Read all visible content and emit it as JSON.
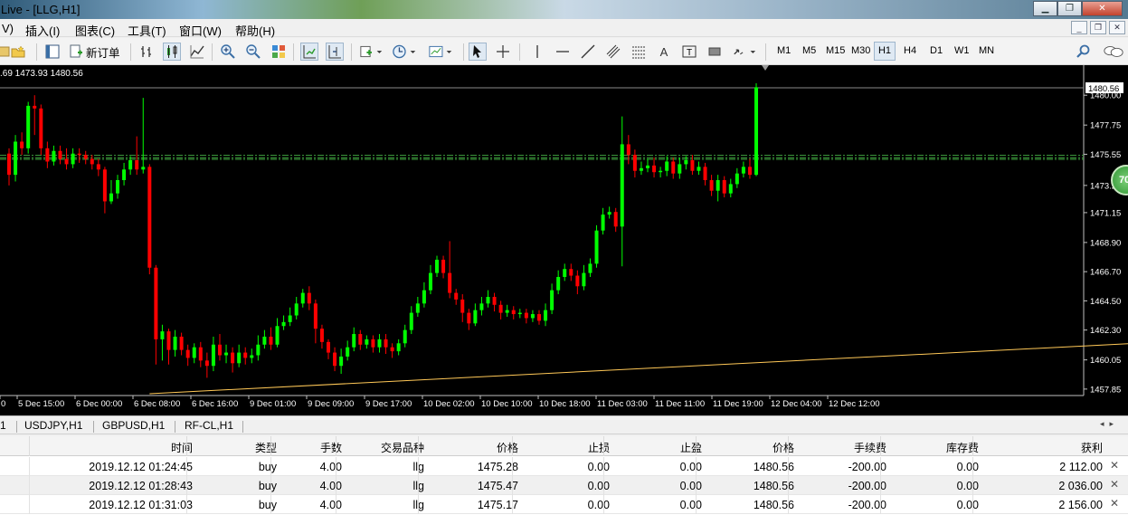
{
  "window": {
    "title": "Live - [LLG,H1]"
  },
  "menu": {
    "items": [
      "V)",
      "插入(I)",
      "图表(C)",
      "工具(T)",
      "窗口(W)",
      "帮助(H)"
    ]
  },
  "toolbar": {
    "new_order_label": "新订单",
    "timeframes": [
      "M1",
      "M5",
      "M15",
      "M30",
      "H1",
      "H4",
      "D1",
      "W1",
      "MN"
    ],
    "active_timeframe": "H1"
  },
  "chart": {
    "ohlc_text": ".69 1473.93 1480.56",
    "price_badge": "1480.56",
    "trade_bubble": "70",
    "colors": {
      "bull": "#00ff00",
      "bear": "#ff0000",
      "background": "#000000",
      "grid": "#c0c0c0",
      "trendline": "#ffc857",
      "level_line": "#3fa33f"
    }
  },
  "chart_data": {
    "type": "candlestick",
    "symbol": "LLG",
    "timeframe": "H1",
    "y_ticks": [
      "1480.00",
      "1477.75",
      "1475.55",
      "1473.20",
      "1471.15",
      "1468.90",
      "1466.70",
      "1464.50",
      "1462.30",
      "1460.05",
      "1457.85"
    ],
    "ylim": [
      1457.5,
      1480.9
    ],
    "x_ticks": [
      "0",
      "5 Dec 15:00",
      "6 Dec 00:00",
      "6 Dec 08:00",
      "6 Dec 16:00",
      "9 Dec 01:00",
      "9 Dec 09:00",
      "9 Dec 17:00",
      "10 Dec 02:00",
      "10 Dec 10:00",
      "10 Dec 18:00",
      "11 Dec 03:00",
      "11 Dec 11:00",
      "11 Dec 19:00",
      "12 Dec 04:00",
      "12 Dec 12:00"
    ],
    "last_price": 1480.56,
    "levels": [
      1475.47,
      1475.28,
      1475.17
    ],
    "trendline": {
      "from": {
        "index": 22,
        "price": 1457.5
      },
      "to": {
        "index": 205,
        "price": 1462.0
      }
    },
    "candles": [
      [
        1475.6,
        1474.0,
        1476.0,
        1473.2
      ],
      [
        1474.0,
        1476.5,
        1477.0,
        1473.5
      ],
      [
        1476.5,
        1476.0,
        1477.2,
        1475.5
      ],
      [
        1476.0,
        1479.2,
        1479.5,
        1475.6
      ],
      [
        1479.2,
        1479.0,
        1480.0,
        1477.0
      ],
      [
        1479.0,
        1476.0,
        1479.3,
        1475.5
      ],
      [
        1476.0,
        1475.0,
        1476.5,
        1474.5
      ],
      [
        1475.0,
        1475.8,
        1476.2,
        1474.7
      ],
      [
        1475.8,
        1475.2,
        1476.2,
        1474.8
      ],
      [
        1475.2,
        1474.8,
        1476.0,
        1474.4
      ],
      [
        1474.8,
        1475.6,
        1476.0,
        1474.5
      ],
      [
        1475.6,
        1475.5,
        1476.0,
        1474.9
      ],
      [
        1475.5,
        1475.2,
        1475.8,
        1474.8
      ],
      [
        1475.2,
        1474.8,
        1475.5,
        1474.4
      ],
      [
        1474.8,
        1474.4,
        1475.2,
        1473.9
      ],
      [
        1474.4,
        1472.0,
        1474.6,
        1471.1
      ],
      [
        1472.0,
        1472.6,
        1473.6,
        1471.8
      ],
      [
        1472.6,
        1473.6,
        1474.0,
        1472.2
      ],
      [
        1473.6,
        1474.4,
        1474.9,
        1473.2
      ],
      [
        1474.4,
        1475.1,
        1475.4,
        1474.0
      ],
      [
        1475.1,
        1474.4,
        1476.9,
        1474.0
      ],
      [
        1474.4,
        1474.6,
        1479.8,
        1474.1
      ],
      [
        1474.6,
        1467.0,
        1474.8,
        1466.5
      ],
      [
        1467.0,
        1461.6,
        1467.2,
        1459.7
      ],
      [
        1461.6,
        1462.2,
        1462.7,
        1460.0
      ],
      [
        1462.2,
        1460.8,
        1462.4,
        1459.7
      ],
      [
        1460.8,
        1461.8,
        1462.3,
        1460.3
      ],
      [
        1461.8,
        1460.8,
        1462.1,
        1460.4
      ],
      [
        1460.8,
        1460.2,
        1461.2,
        1459.6
      ],
      [
        1460.2,
        1461.0,
        1461.3,
        1459.8
      ],
      [
        1461.0,
        1460.0,
        1461.4,
        1459.5
      ],
      [
        1460.0,
        1459.6,
        1460.6,
        1458.7
      ],
      [
        1459.6,
        1461.2,
        1461.8,
        1459.2
      ],
      [
        1461.2,
        1460.4,
        1462.0,
        1460.0
      ],
      [
        1460.4,
        1460.6,
        1461.2,
        1459.8
      ],
      [
        1460.6,
        1459.8,
        1461.0,
        1459.1
      ],
      [
        1459.8,
        1460.6,
        1461.2,
        1459.5
      ],
      [
        1460.6,
        1460.2,
        1461.0,
        1459.7
      ],
      [
        1460.2,
        1460.4,
        1460.9,
        1459.8
      ],
      [
        1460.4,
        1461.2,
        1461.9,
        1460.0
      ],
      [
        1461.2,
        1461.8,
        1462.3,
        1460.9
      ],
      [
        1461.8,
        1461.2,
        1462.5,
        1460.8
      ],
      [
        1461.2,
        1462.6,
        1463.2,
        1461.0
      ],
      [
        1462.6,
        1462.9,
        1463.4,
        1462.3
      ],
      [
        1462.9,
        1463.4,
        1464.0,
        1462.6
      ],
      [
        1463.4,
        1464.3,
        1464.8,
        1463.1
      ],
      [
        1464.3,
        1465.1,
        1465.4,
        1464.0
      ],
      [
        1465.1,
        1464.3,
        1465.6,
        1463.8
      ],
      [
        1464.3,
        1462.4,
        1464.6,
        1461.3
      ],
      [
        1462.4,
        1461.4,
        1462.7,
        1460.9
      ],
      [
        1461.4,
        1460.6,
        1461.6,
        1460.1
      ],
      [
        1460.6,
        1459.6,
        1461.0,
        1459.2
      ],
      [
        1459.6,
        1460.3,
        1460.9,
        1459.0
      ],
      [
        1460.3,
        1461.0,
        1461.5,
        1460.0
      ],
      [
        1461.0,
        1462.0,
        1462.5,
        1460.7
      ],
      [
        1462.0,
        1461.2,
        1462.3,
        1460.8
      ],
      [
        1461.2,
        1461.6,
        1461.9,
        1460.9
      ],
      [
        1461.6,
        1461.0,
        1461.9,
        1460.6
      ],
      [
        1461.0,
        1461.6,
        1462.0,
        1460.6
      ],
      [
        1461.6,
        1461.0,
        1462.0,
        1460.5
      ],
      [
        1461.0,
        1460.7,
        1461.3,
        1460.2
      ],
      [
        1460.7,
        1461.3,
        1461.6,
        1460.4
      ],
      [
        1461.3,
        1462.3,
        1462.7,
        1461.0
      ],
      [
        1462.3,
        1463.6,
        1464.1,
        1462.0
      ],
      [
        1463.6,
        1464.3,
        1464.8,
        1463.3
      ],
      [
        1464.3,
        1465.3,
        1465.9,
        1464.0
      ],
      [
        1465.3,
        1466.6,
        1467.2,
        1465.0
      ],
      [
        1466.6,
        1467.6,
        1467.9,
        1466.3
      ],
      [
        1467.6,
        1466.6,
        1467.9,
        1466.2
      ],
      [
        1466.6,
        1465.1,
        1469.0,
        1464.7
      ],
      [
        1465.1,
        1464.6,
        1465.4,
        1464.2
      ],
      [
        1464.6,
        1463.6,
        1465.0,
        1462.9
      ],
      [
        1463.6,
        1462.8,
        1463.9,
        1462.3
      ],
      [
        1462.8,
        1463.8,
        1464.3,
        1462.6
      ],
      [
        1463.8,
        1464.3,
        1464.8,
        1463.4
      ],
      [
        1464.3,
        1464.8,
        1465.3,
        1464.0
      ],
      [
        1464.8,
        1464.2,
        1465.1,
        1463.7
      ],
      [
        1464.2,
        1463.6,
        1464.5,
        1463.1
      ],
      [
        1463.6,
        1463.8,
        1464.2,
        1463.3
      ],
      [
        1463.8,
        1463.5,
        1464.1,
        1463.1
      ],
      [
        1463.5,
        1463.6,
        1463.9,
        1463.2
      ],
      [
        1463.6,
        1463.2,
        1463.9,
        1462.8
      ],
      [
        1463.2,
        1463.5,
        1463.8,
        1462.9
      ],
      [
        1463.5,
        1463.0,
        1463.8,
        1462.7
      ],
      [
        1463.0,
        1463.8,
        1464.3,
        1462.6
      ],
      [
        1463.8,
        1465.3,
        1465.8,
        1463.5
      ],
      [
        1465.3,
        1466.3,
        1466.8,
        1465.0
      ],
      [
        1466.3,
        1466.9,
        1467.3,
        1466.0
      ],
      [
        1466.9,
        1466.4,
        1467.3,
        1466.0
      ],
      [
        1466.4,
        1465.6,
        1466.8,
        1465.0
      ],
      [
        1465.6,
        1466.6,
        1467.2,
        1465.3
      ],
      [
        1466.6,
        1467.3,
        1467.7,
        1466.3
      ],
      [
        1467.3,
        1469.8,
        1470.2,
        1467.0
      ],
      [
        1469.8,
        1471.0,
        1471.5,
        1469.5
      ],
      [
        1471.0,
        1471.2,
        1471.6,
        1470.7
      ],
      [
        1471.2,
        1470.1,
        1471.5,
        1469.7
      ],
      [
        1470.1,
        1476.3,
        1478.4,
        1467.1
      ],
      [
        1476.3,
        1475.5,
        1477.0,
        1474.8
      ],
      [
        1475.5,
        1474.3,
        1475.9,
        1473.8
      ],
      [
        1474.3,
        1474.5,
        1475.0,
        1474.0
      ],
      [
        1474.5,
        1474.7,
        1475.2,
        1474.2
      ],
      [
        1474.7,
        1474.2,
        1475.3,
        1473.8
      ],
      [
        1474.2,
        1474.3,
        1474.6,
        1473.8
      ],
      [
        1474.3,
        1475.0,
        1475.4,
        1473.9
      ],
      [
        1475.0,
        1474.1,
        1475.3,
        1473.7
      ],
      [
        1474.1,
        1474.8,
        1475.3,
        1473.7
      ],
      [
        1474.8,
        1475.1,
        1475.4,
        1474.4
      ],
      [
        1475.1,
        1474.3,
        1475.5,
        1474.0
      ],
      [
        1474.3,
        1474.6,
        1475.0,
        1474.0
      ],
      [
        1474.6,
        1473.6,
        1474.9,
        1473.2
      ],
      [
        1473.6,
        1472.8,
        1474.0,
        1472.4
      ],
      [
        1472.8,
        1473.6,
        1474.0,
        1472.0
      ],
      [
        1473.6,
        1472.6,
        1473.9,
        1472.3
      ],
      [
        1472.6,
        1473.3,
        1473.7,
        1472.3
      ],
      [
        1473.3,
        1474.1,
        1474.5,
        1473.0
      ],
      [
        1474.1,
        1474.6,
        1475.0,
        1473.8
      ],
      [
        1474.6,
        1474.0,
        1475.2,
        1473.7
      ],
      [
        1474.0,
        1480.6,
        1480.9,
        1473.9
      ]
    ]
  },
  "symbol_tabs": [
    "1",
    "USDJPY,H1",
    "GBPUSD,H1",
    "RF-CL,H1"
  ],
  "trades": {
    "headers": [
      "时间",
      "类型",
      "手数",
      "交易品种",
      "价格",
      "止损",
      "止盈",
      "价格",
      "手续费",
      "库存费",
      "获利"
    ],
    "rows": [
      [
        "2019.12.12 01:24:45",
        "buy",
        "4.00",
        "llg",
        "1475.28",
        "0.00",
        "0.00",
        "1480.56",
        "-200.00",
        "0.00",
        "2 112.00"
      ],
      [
        "2019.12.12 01:28:43",
        "buy",
        "4.00",
        "llg",
        "1475.47",
        "0.00",
        "0.00",
        "1480.56",
        "-200.00",
        "0.00",
        "2 036.00"
      ],
      [
        "2019.12.12 01:31:03",
        "buy",
        "4.00",
        "llg",
        "1475.17",
        "0.00",
        "0.00",
        "1480.56",
        "-200.00",
        "0.00",
        "2 156.00"
      ]
    ]
  }
}
